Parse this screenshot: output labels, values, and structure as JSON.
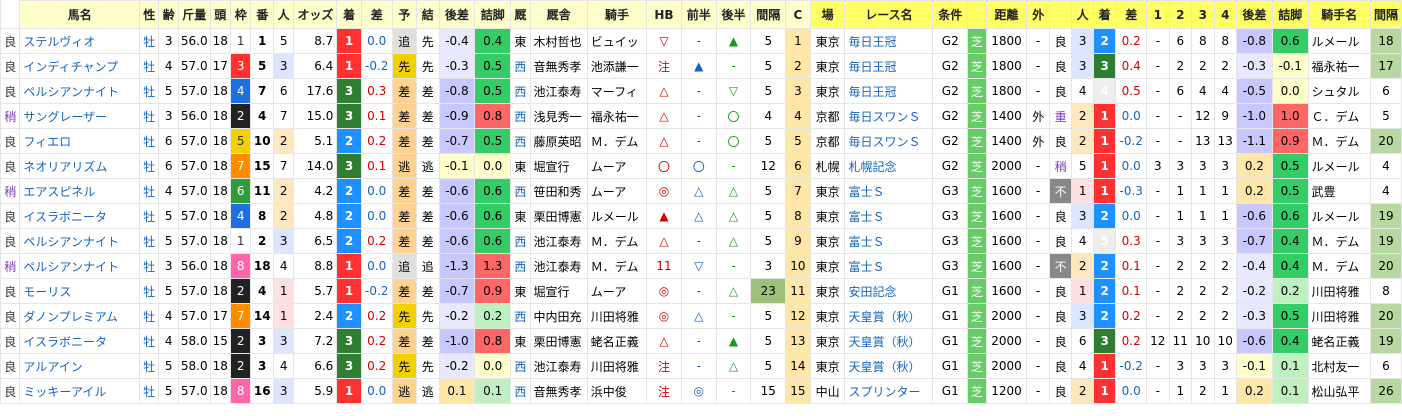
{
  "headers": [
    "馬名",
    "性",
    "齢",
    "斤量",
    "頭",
    "枠",
    "番",
    "人",
    "オッズ",
    "着",
    "差",
    "予",
    "結",
    "後差",
    "詰脚",
    "厩",
    "厩舎",
    "騎手",
    "HB",
    "前半",
    "後半",
    "間隔",
    "C",
    "場",
    "レース名",
    "条件",
    "",
    "距離",
    "外",
    "",
    "人",
    "着",
    "差",
    "1",
    "2",
    "3",
    "4",
    "後差",
    "詰脚",
    "騎手名",
    "間隔"
  ],
  "colors": {
    "win": "#ff3030",
    "second": "#1e90ff",
    "third": "#2e7d32",
    "cleanBg": "#ffffcc",
    "good": "#33cc33",
    "bad": "#ff6666"
  },
  "rows": [
    {
      "baba": "良",
      "name": "ステルヴィオ",
      "sex": "牡",
      "age": "3",
      "kinryo": "56.0",
      "tosu": "18",
      "waku": "1",
      "ban": "1",
      "ninki": "5",
      "odds": "8.7",
      "chaku": "1",
      "sa": "0.0",
      "yo": "追",
      "ketsu": "先",
      "kosa": "-0.4",
      "tsume": "0.4",
      "kyu": "東",
      "kyusha": "木村哲也",
      "jockey": "ビュイッ",
      "hb": "▽",
      "zen": "-",
      "ko": "▲",
      "kankaku": "5",
      "c": "1",
      "jo": "東京",
      "race": "毎日王冠",
      "cond": "G2",
      "shiba": "芝",
      "kyori": "1800",
      "soto": "-",
      "baba2": "良",
      "n2": "3",
      "c2": "2",
      "s2": "0.2",
      "p1": "-",
      "p2": "6",
      "p3": "8",
      "p4": "8",
      "ks2": "-0.8",
      "ts2": "0.6",
      "jockey2": "ルメール",
      "k2": "18"
    },
    {
      "baba": "良",
      "name": "インディチャンプ",
      "sex": "牡",
      "age": "4",
      "kinryo": "57.0",
      "tosu": "17",
      "waku": "3",
      "ban": "5",
      "ninki": "3",
      "odds": "6.4",
      "chaku": "1",
      "sa": "-0.2",
      "yo": "先",
      "ketsu": "先",
      "kosa": "-0.3",
      "tsume": "0.5",
      "kyu": "西",
      "kyusha": "音無秀孝",
      "jockey": "池添謙一",
      "hb": "注",
      "zen": "▲",
      "ko": "-",
      "kankaku": "5",
      "c": "2",
      "jo": "東京",
      "race": "毎日王冠",
      "cond": "G2",
      "shiba": "芝",
      "kyori": "1800",
      "soto": "-",
      "baba2": "良",
      "n2": "3",
      "c2": "3",
      "s2": "0.4",
      "p1": "-",
      "p2": "2",
      "p3": "2",
      "p4": "2",
      "ks2": "-0.3",
      "ts2": "-0.1",
      "jockey2": "福永祐一",
      "k2": "17"
    },
    {
      "baba": "良",
      "name": "ペルシアンナイト",
      "sex": "牡",
      "age": "5",
      "kinryo": "57.0",
      "tosu": "18",
      "waku": "4",
      "ban": "7",
      "ninki": "6",
      "odds": "17.6",
      "chaku": "3",
      "sa": "0.3",
      "yo": "差",
      "ketsu": "差",
      "kosa": "-0.8",
      "tsume": "0.5",
      "kyu": "西",
      "kyusha": "池江泰寿",
      "jockey": "マーフィ",
      "hb": "△",
      "zen": "-",
      "ko": "▽",
      "kankaku": "5",
      "c": "3",
      "jo": "東京",
      "race": "毎日王冠",
      "cond": "G2",
      "shiba": "芝",
      "kyori": "1800",
      "soto": "-",
      "baba2": "良",
      "n2": "4",
      "c2": "4",
      "s2": "0.5",
      "p1": "-",
      "p2": "6",
      "p3": "4",
      "p4": "4",
      "ks2": "-0.5",
      "ts2": "0.0",
      "jockey2": "シュタル",
      "k2": "6"
    },
    {
      "baba": "稍",
      "name": "サングレーザー",
      "sex": "牡",
      "age": "3",
      "kinryo": "56.0",
      "tosu": "18",
      "waku": "2",
      "ban": "4",
      "ninki": "7",
      "odds": "15.0",
      "chaku": "3",
      "sa": "0.1",
      "yo": "差",
      "ketsu": "差",
      "kosa": "-0.9",
      "tsume": "0.8",
      "kyu": "西",
      "kyusha": "浅見秀一",
      "jockey": "福永祐一",
      "hb": "△",
      "zen": "-",
      "ko": "〇",
      "kankaku": "4",
      "c": "4",
      "jo": "京都",
      "race": "毎日スワンＳ",
      "cond": "G2",
      "shiba": "芝",
      "kyori": "1400",
      "soto": "外",
      "baba2": "重",
      "n2": "2",
      "c2": "1",
      "s2": "0.0",
      "p1": "-",
      "p2": "-",
      "p3": "12",
      "p4": "9",
      "ks2": "-1.0",
      "ts2": "1.0",
      "jockey2": "Ｃ．デム",
      "k2": "5"
    },
    {
      "baba": "良",
      "name": "フィエロ",
      "sex": "牡",
      "age": "6",
      "kinryo": "57.0",
      "tosu": "18",
      "waku": "5",
      "ban": "10",
      "ninki": "2",
      "odds": "5.1",
      "chaku": "2",
      "sa": "0.2",
      "yo": "差",
      "ketsu": "差",
      "kosa": "-0.7",
      "tsume": "0.5",
      "kyu": "西",
      "kyusha": "藤原英昭",
      "jockey": "Ｍ．デム",
      "hb": "△",
      "zen": "-",
      "ko": "〇",
      "kankaku": "5",
      "c": "5",
      "jo": "京都",
      "race": "毎日スワンＳ",
      "cond": "G2",
      "shiba": "芝",
      "kyori": "1400",
      "soto": "外",
      "baba2": "良",
      "n2": "2",
      "c2": "1",
      "s2": "-0.2",
      "p1": "-",
      "p2": "-",
      "p3": "13",
      "p4": "13",
      "ks2": "-1.1",
      "ts2": "0.9",
      "jockey2": "Ｍ．デム",
      "k2": "20"
    },
    {
      "baba": "良",
      "name": "ネオリアリズム",
      "sex": "牡",
      "age": "6",
      "kinryo": "57.0",
      "tosu": "18",
      "waku": "7",
      "ban": "15",
      "ninki": "7",
      "odds": "14.0",
      "chaku": "3",
      "sa": "0.1",
      "yo": "逃",
      "ketsu": "逃",
      "kosa": "-0.1",
      "tsume": "0.0",
      "kyu": "東",
      "kyusha": "堀宣行",
      "jockey": "ムーア",
      "hb": "〇",
      "zen": "〇",
      "ko": "-",
      "kankaku": "12",
      "c": "6",
      "jo": "札幌",
      "race": "札幌記念",
      "cond": "G2",
      "shiba": "芝",
      "kyori": "2000",
      "soto": "-",
      "baba2": "稍",
      "n2": "5",
      "c2": "1",
      "s2": "0.0",
      "p1": "3",
      "p2": "3",
      "p3": "3",
      "p4": "3",
      "ks2": "0.2",
      "ts2": "0.5",
      "jockey2": "ルメール",
      "k2": "4"
    },
    {
      "baba": "稍",
      "name": "エアスピネル",
      "sex": "牡",
      "age": "4",
      "kinryo": "57.0",
      "tosu": "18",
      "waku": "6",
      "ban": "11",
      "ninki": "2",
      "odds": "4.2",
      "chaku": "2",
      "sa": "0.0",
      "yo": "差",
      "ketsu": "差",
      "kosa": "-0.6",
      "tsume": "0.6",
      "kyu": "西",
      "kyusha": "笹田和秀",
      "jockey": "ムーア",
      "hb": "◎",
      "zen": "△",
      "ko": "△",
      "kankaku": "5",
      "c": "7",
      "jo": "東京",
      "race": "富士Ｓ",
      "cond": "G3",
      "shiba": "芝",
      "kyori": "1600",
      "soto": "-",
      "baba2": "不",
      "n2": "1",
      "c2": "1",
      "s2": "-0.3",
      "p1": "-",
      "p2": "1",
      "p3": "1",
      "p4": "1",
      "ks2": "0.2",
      "ts2": "0.5",
      "jockey2": "武豊",
      "k2": "4"
    },
    {
      "baba": "良",
      "name": "イスラボニータ",
      "sex": "牡",
      "age": "5",
      "kinryo": "57.0",
      "tosu": "18",
      "waku": "4",
      "ban": "8",
      "ninki": "2",
      "odds": "4.8",
      "chaku": "2",
      "sa": "0.0",
      "yo": "差",
      "ketsu": "差",
      "kosa": "-0.6",
      "tsume": "0.6",
      "kyu": "東",
      "kyusha": "栗田博憲",
      "jockey": "ルメール",
      "hb": "▲",
      "zen": "△",
      "ko": "△",
      "kankaku": "5",
      "c": "8",
      "jo": "東京",
      "race": "富士Ｓ",
      "cond": "G3",
      "shiba": "芝",
      "kyori": "1600",
      "soto": "-",
      "baba2": "良",
      "n2": "3",
      "c2": "2",
      "s2": "0.0",
      "p1": "-",
      "p2": "1",
      "p3": "1",
      "p4": "1",
      "ks2": "-0.6",
      "ts2": "0.6",
      "jockey2": "ルメール",
      "k2": "19"
    },
    {
      "baba": "良",
      "name": "ペルシアンナイト",
      "sex": "牡",
      "age": "5",
      "kinryo": "57.0",
      "tosu": "18",
      "waku": "1",
      "ban": "2",
      "ninki": "3",
      "odds": "6.5",
      "chaku": "2",
      "sa": "0.2",
      "yo": "差",
      "ketsu": "差",
      "kosa": "-0.6",
      "tsume": "0.6",
      "kyu": "西",
      "kyusha": "池江泰寿",
      "jockey": "Ｍ．デム",
      "hb": "△",
      "zen": "-",
      "ko": "△",
      "kankaku": "5",
      "c": "9",
      "jo": "東京",
      "race": "富士Ｓ",
      "cond": "G3",
      "shiba": "芝",
      "kyori": "1600",
      "soto": "-",
      "baba2": "良",
      "n2": "4",
      "c2": "5",
      "s2": "0.3",
      "p1": "-",
      "p2": "3",
      "p3": "3",
      "p4": "3",
      "ks2": "-0.7",
      "ts2": "0.4",
      "jockey2": "Ｍ．デム",
      "k2": "19"
    },
    {
      "baba": "稍",
      "name": "ペルシアンナイト",
      "sex": "牡",
      "age": "3",
      "kinryo": "56.0",
      "tosu": "18",
      "waku": "8",
      "ban": "18",
      "ninki": "4",
      "odds": "8.8",
      "chaku": "1",
      "sa": "0.0",
      "yo": "追",
      "ketsu": "追",
      "kosa": "-1.3",
      "tsume": "1.3",
      "kyu": "西",
      "kyusha": "池江泰寿",
      "jockey": "Ｍ．デム",
      "hb": "11",
      "zen": "▽",
      "ko": "-",
      "kankaku": "3",
      "c": "10",
      "jo": "東京",
      "race": "富士Ｓ",
      "cond": "G3",
      "shiba": "芝",
      "kyori": "1600",
      "soto": "-",
      "baba2": "不",
      "n2": "2",
      "c2": "2",
      "s2": "0.1",
      "p1": "-",
      "p2": "2",
      "p3": "2",
      "p4": "2",
      "ks2": "-0.4",
      "ts2": "0.4",
      "jockey2": "Ｍ．デム",
      "k2": "20"
    },
    {
      "baba": "良",
      "name": "モーリス",
      "sex": "牡",
      "age": "5",
      "kinryo": "57.0",
      "tosu": "18",
      "waku": "2",
      "ban": "4",
      "ninki": "1",
      "odds": "5.7",
      "chaku": "1",
      "sa": "-0.2",
      "yo": "差",
      "ketsu": "差",
      "kosa": "-0.7",
      "tsume": "0.9",
      "kyu": "東",
      "kyusha": "堀宣行",
      "jockey": "ムーア",
      "hb": "◎",
      "zen": "-",
      "ko": "△",
      "kankaku": "23",
      "c": "11",
      "jo": "東京",
      "race": "安田記念",
      "cond": "G1",
      "shiba": "芝",
      "kyori": "1600",
      "soto": "-",
      "baba2": "良",
      "n2": "1",
      "c2": "2",
      "s2": "0.1",
      "p1": "-",
      "p2": "2",
      "p3": "2",
      "p4": "2",
      "ks2": "-0.2",
      "ts2": "0.2",
      "jockey2": "川田将雅",
      "k2": "8"
    },
    {
      "baba": "良",
      "name": "ダノンプレミアム",
      "sex": "牡",
      "age": "4",
      "kinryo": "57.0",
      "tosu": "17",
      "waku": "7",
      "ban": "14",
      "ninki": "1",
      "odds": "2.4",
      "chaku": "2",
      "sa": "0.2",
      "yo": "先",
      "ketsu": "先",
      "kosa": "-0.2",
      "tsume": "0.2",
      "kyu": "西",
      "kyusha": "中内田充",
      "jockey": "川田将雅",
      "hb": "◎",
      "zen": "△",
      "ko": "-",
      "kankaku": "5",
      "c": "12",
      "jo": "東京",
      "race": "天皇賞（秋）",
      "cond": "G1",
      "shiba": "芝",
      "kyori": "2000",
      "soto": "-",
      "baba2": "良",
      "n2": "3",
      "c2": "2",
      "s2": "0.2",
      "p1": "-",
      "p2": "2",
      "p3": "2",
      "p4": "2",
      "ks2": "-0.3",
      "ts2": "0.5",
      "jockey2": "川田将雅",
      "k2": "20"
    },
    {
      "baba": "良",
      "name": "イスラボニータ",
      "sex": "牡",
      "age": "4",
      "kinryo": "58.0",
      "tosu": "15",
      "waku": "2",
      "ban": "3",
      "ninki": "3",
      "odds": "7.2",
      "chaku": "3",
      "sa": "0.2",
      "yo": "差",
      "ketsu": "差",
      "kosa": "-1.0",
      "tsume": "0.8",
      "kyu": "東",
      "kyusha": "栗田博憲",
      "jockey": "蛯名正義",
      "hb": "△",
      "zen": "-",
      "ko": "▲",
      "kankaku": "5",
      "c": "13",
      "jo": "東京",
      "race": "天皇賞（秋）",
      "cond": "G1",
      "shiba": "芝",
      "kyori": "2000",
      "soto": "-",
      "baba2": "良",
      "n2": "6",
      "c2": "3",
      "s2": "0.2",
      "p1": "12",
      "p2": "11",
      "p3": "10",
      "p4": "10",
      "ks2": "-0.6",
      "ts2": "0.4",
      "jockey2": "蛯名正義",
      "k2": "19"
    },
    {
      "baba": "良",
      "name": "アルアイン",
      "sex": "牡",
      "age": "5",
      "kinryo": "58.0",
      "tosu": "18",
      "waku": "2",
      "ban": "3",
      "ninki": "4",
      "odds": "6.6",
      "chaku": "3",
      "sa": "0.2",
      "yo": "先",
      "ketsu": "先",
      "kosa": "-0.2",
      "tsume": "0.0",
      "kyu": "西",
      "kyusha": "池江泰寿",
      "jockey": "川田将雅",
      "hb": "注",
      "zen": "-",
      "ko": "△",
      "kankaku": "5",
      "c": "14",
      "jo": "東京",
      "race": "天皇賞（秋）",
      "cond": "G1",
      "shiba": "芝",
      "kyori": "2000",
      "soto": "-",
      "baba2": "良",
      "n2": "4",
      "c2": "1",
      "s2": "-0.2",
      "p1": "-",
      "p2": "3",
      "p3": "3",
      "p4": "3",
      "ks2": "-0.1",
      "ts2": "0.1",
      "jockey2": "北村友一",
      "k2": "6"
    },
    {
      "baba": "良",
      "name": "ミッキーアイル",
      "sex": "牡",
      "age": "5",
      "kinryo": "57.0",
      "tosu": "18",
      "waku": "8",
      "ban": "16",
      "ninki": "3",
      "odds": "5.9",
      "chaku": "1",
      "sa": "0.0",
      "yo": "逃",
      "ketsu": "逃",
      "kosa": "0.1",
      "tsume": "0.1",
      "kyu": "西",
      "kyusha": "音無秀孝",
      "jockey": "浜中俊",
      "hb": "注",
      "zen": "◎",
      "ko": "-",
      "kankaku": "15",
      "c": "15",
      "jo": "中山",
      "race": "スプリンター",
      "cond": "G1",
      "shiba": "芝",
      "kyori": "1200",
      "soto": "-",
      "baba2": "良",
      "n2": "2",
      "c2": "1",
      "s2": "0.0",
      "p1": "-",
      "p2": "1",
      "p3": "2",
      "p4": "1",
      "ks2": "0.2",
      "ts2": "0.1",
      "jockey2": "松山弘平",
      "k2": "26"
    }
  ]
}
